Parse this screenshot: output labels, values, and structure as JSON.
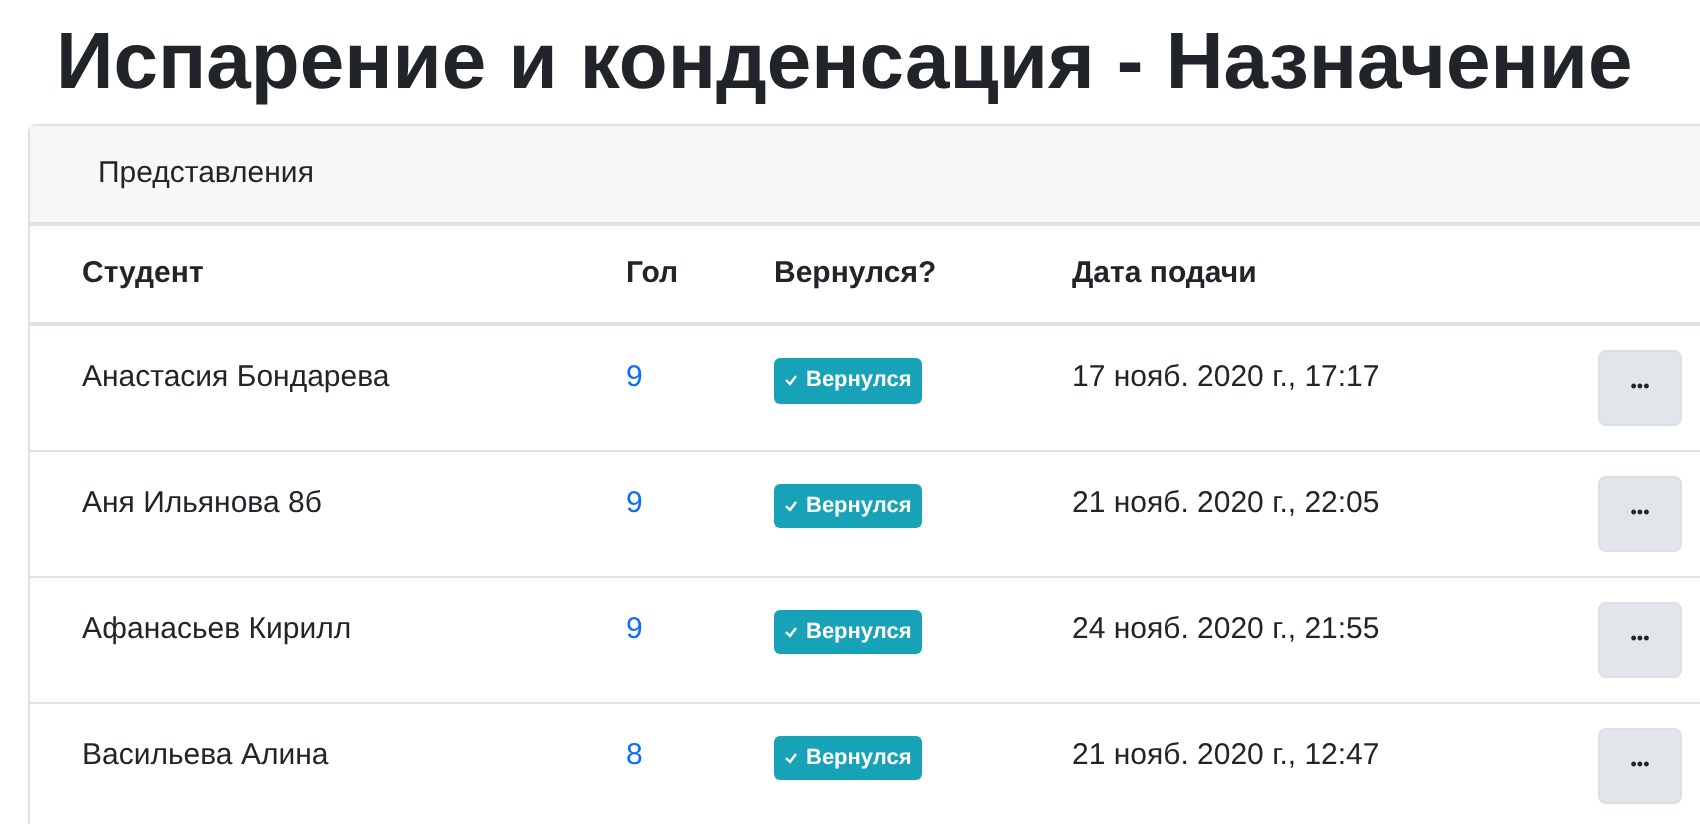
{
  "title": "Испарение и конденсация - Назначение",
  "card_header": "Представления",
  "table": {
    "columns": [
      "Студент",
      "Гол",
      "Вернулся?",
      "Дата подачи"
    ],
    "rows": [
      {
        "student": "Анастасия Бондарева",
        "score": "9",
        "returned": true,
        "status": "Вернулся",
        "date": "17 нояб. 2020 г., 17:17",
        "menu": "•••"
      },
      {
        "student": "Аня Ильянова 8б",
        "score": "9",
        "returned": true,
        "status": "Вернулся",
        "date": "21 нояб. 2020 г., 22:05",
        "menu": "•••"
      },
      {
        "student": "Афанасьев Кирилл",
        "score": "9",
        "returned": true,
        "status": "Вернулся",
        "date": "24 нояб. 2020 г., 21:55",
        "menu": "•••"
      },
      {
        "student": "Васильева Алина",
        "score": "8",
        "returned": true,
        "status": "Вернулся",
        "date": "21 нояб. 2020 г., 12:47",
        "menu": "•••"
      }
    ]
  }
}
